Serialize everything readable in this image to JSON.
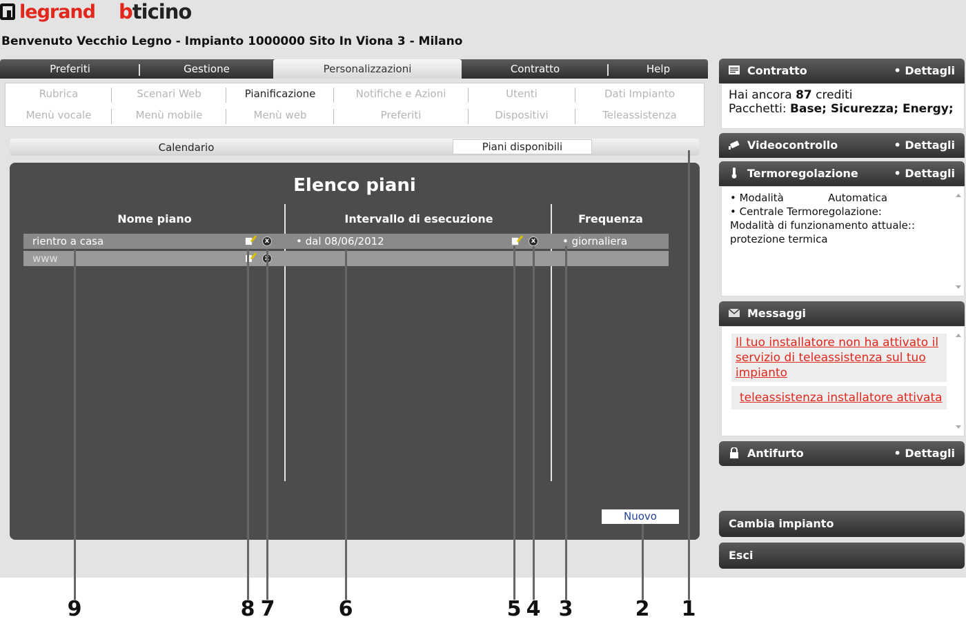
{
  "header": {
    "legrand": "legrand",
    "bticino_b": "b",
    "bticino_rest": "ticino",
    "welcome": "Benvenuto Vecchio Legno - Impianto 1000000 Sito In Viona 3 - Milano"
  },
  "main_tabs": [
    "Preferiti",
    "Gestione",
    "Personalizzazioni",
    "Contratto",
    "Help"
  ],
  "submenu": {
    "row1": [
      "Rubrica",
      "Scenari Web",
      "Pianificazione",
      "Notifiche e Azioni",
      "Utenti",
      "Dati Impianto"
    ],
    "row2": [
      "Menù vocale",
      "Menù mobile",
      "Menù web",
      "Preferiti",
      "Dispositivi",
      "Teleassistenza"
    ],
    "active": "Pianificazione"
  },
  "inner_tabs": [
    "Calendario",
    "Piani disponibili"
  ],
  "panel": {
    "title": "Elenco piani",
    "columns": [
      "Nome piano",
      "Intervallo di esecuzione",
      "Frequenza"
    ],
    "rows": [
      {
        "name": "rientro a casa",
        "interval": "• dal 08/06/2012",
        "frequency": "• giornaliera"
      },
      {
        "name": "www",
        "interval": "",
        "frequency": ""
      }
    ],
    "new_button": "Nuovo",
    "delete_glyph": "x"
  },
  "sidebar": {
    "details_label": "• Dettagli",
    "contratto": {
      "title": "Contratto",
      "credits_prefix": "Hai ancora ",
      "credits": "87",
      "credits_suffix": " crediti",
      "packages_label": "Pacchetti: ",
      "packages": "Base; Sicurezza; Energy;"
    },
    "videocontrollo": {
      "title": "Videocontrollo"
    },
    "termoregolazione": {
      "title": "Termoregolazione",
      "mode_label": "• Modalità",
      "mode_value": "Automatica",
      "central_label": "• Centrale Termoregolazione:",
      "function_label": "Modalità di funzionamento attuale::",
      "function_value": "protezione termica"
    },
    "messaggi": {
      "title": "Messaggi",
      "items": [
        "Il tuo installatore non ha attivato il servizio di teleassistenza sul tuo impianto",
        "teleassistenza installatore attivata"
      ]
    },
    "antifurto": {
      "title": "Antifurto"
    },
    "cambia_impianto": "Cambia impianto",
    "esci": "Esci"
  },
  "callouts": [
    "9",
    "8",
    "7",
    "6",
    "5",
    "4",
    "3",
    "2",
    "1"
  ],
  "colors": {
    "brand_red": "#e1261c",
    "dark_panel": "#4c4c4c",
    "link_blue": "#1f3f9a"
  }
}
